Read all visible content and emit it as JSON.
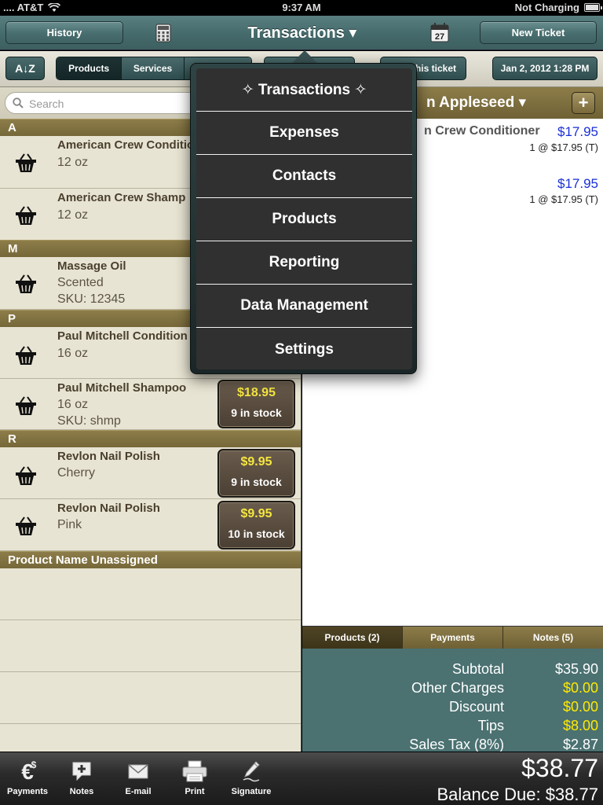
{
  "status_bar": {
    "carrier": ".... AT&T",
    "time": "9:37 AM",
    "battery": "Not Charging"
  },
  "nav": {
    "history": "History",
    "title": "Transactions ▾",
    "new_ticket": "New Ticket",
    "calendar_day": "27"
  },
  "subbar": {
    "sort": "A↓Z",
    "segments": [
      "Products",
      "Services"
    ],
    "this_ticket": "his ticket",
    "date": "Jan 2, 2012 1:28 PM"
  },
  "search": {
    "placeholder": "Search"
  },
  "products": {
    "sections": [
      "A",
      "M",
      "P",
      "R",
      "Product Name Unassigned"
    ],
    "items": [
      {
        "name": "American Crew Condition",
        "desc": "12 oz"
      },
      {
        "name": "American Crew Shamp",
        "desc": "12 oz"
      },
      {
        "name": "Massage Oil",
        "desc": "Scented",
        "sku": "SKU: 12345"
      },
      {
        "name": "Paul Mitchell Condition",
        "desc": "16 oz"
      },
      {
        "name": "Paul Mitchell Shampoo",
        "desc": "16 oz",
        "sku": "SKU: shmp",
        "price": "$18.95",
        "stock": "9 in stock"
      },
      {
        "name": "Revlon Nail Polish",
        "desc": "Cherry",
        "price": "$9.95",
        "stock": "9 in stock"
      },
      {
        "name": "Revlon Nail Polish",
        "desc": "Pink",
        "price": "$9.95",
        "stock": "10 in stock"
      }
    ]
  },
  "ticket": {
    "customer": "n Appleseed ▾",
    "add": "+",
    "items": [
      {
        "name": "n Crew Conditioner",
        "price": "$17.95",
        "qty": "1 @ $17.95 (T)"
      },
      {
        "name": "",
        "price": "$17.95",
        "qty": "1 @ $17.95 (T)"
      }
    ],
    "tabs": [
      "Products (2)",
      "Payments",
      "Notes (5)"
    ],
    "totals": [
      {
        "label": "Subtotal",
        "value": "$35.90"
      },
      {
        "label": "Other Charges",
        "value": "$0.00"
      },
      {
        "label": "Discount",
        "value": "$0.00"
      },
      {
        "label": "Tips",
        "value": "$8.00"
      },
      {
        "label": "Sales Tax (8%)",
        "value": "$2.87"
      }
    ],
    "highlight_color": "#ffea00"
  },
  "toolbar": {
    "items": [
      "Payments",
      "Notes",
      "E-mail",
      "Print",
      "Signature"
    ],
    "grand_total": "$38.77",
    "balance_due": "Balance Due: $38.77"
  },
  "menu": {
    "items": [
      "✧ Transactions ✧",
      "Expenses",
      "Contacts",
      "Products",
      "Reporting",
      "Data Management",
      "Settings"
    ]
  }
}
